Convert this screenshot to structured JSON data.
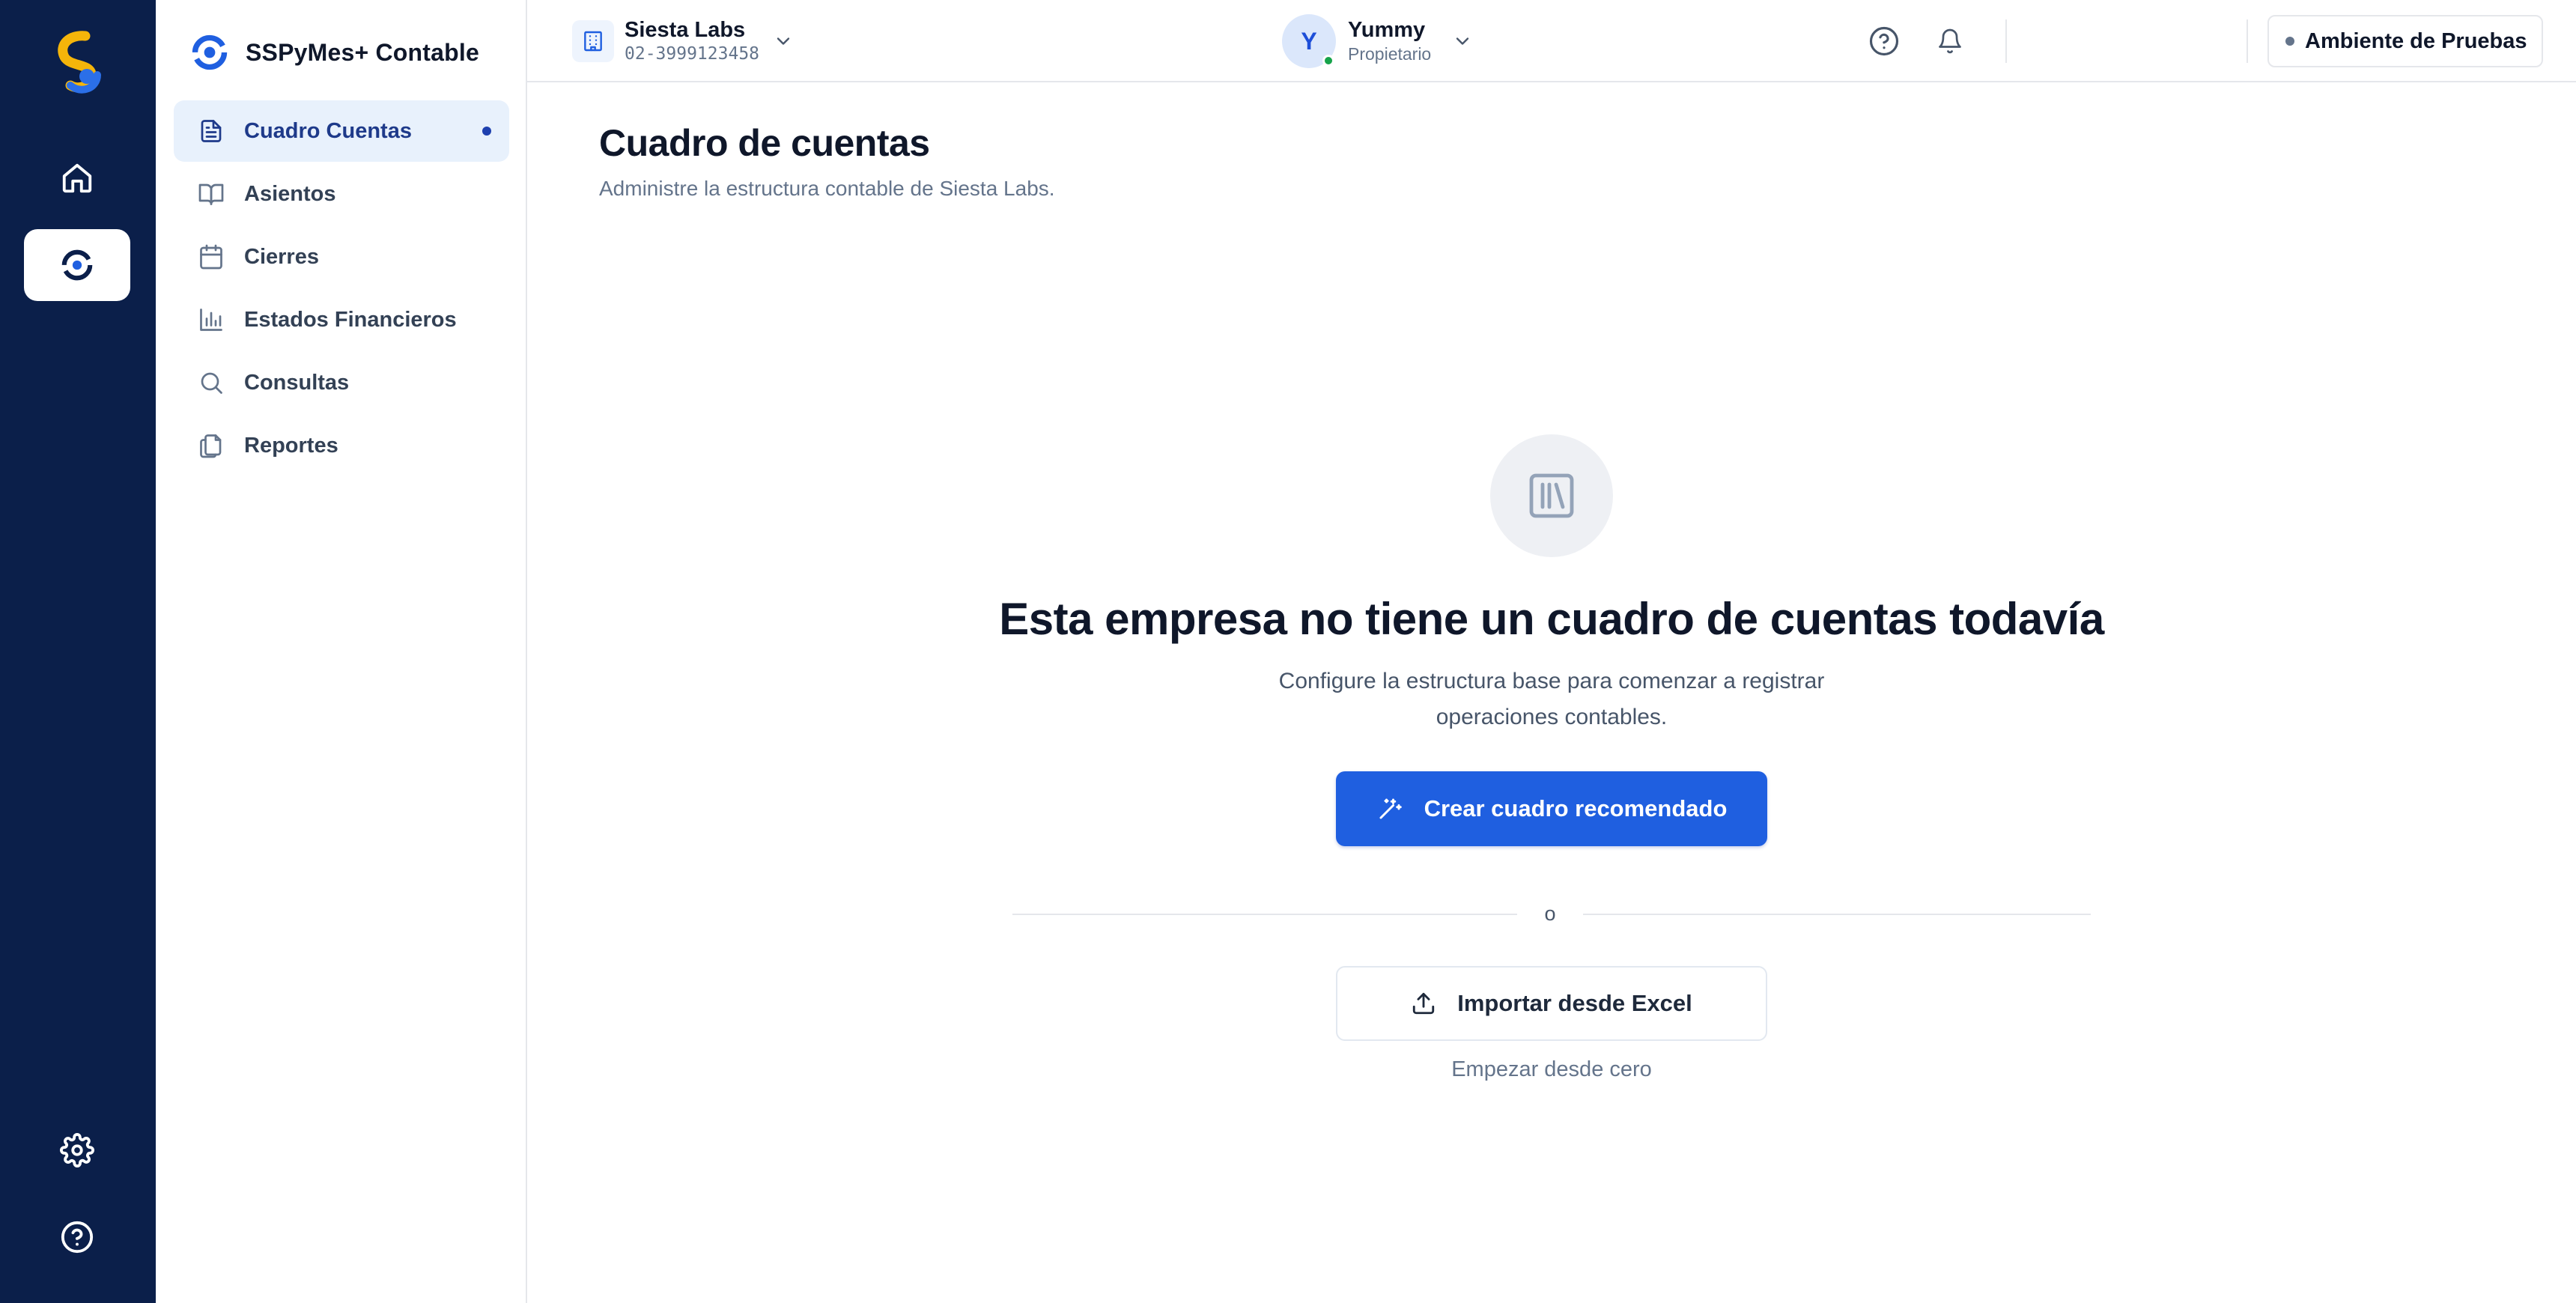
{
  "rail": {
    "items": [
      {
        "name": "home",
        "icon": "home-icon"
      },
      {
        "name": "accounting",
        "icon": "accounting-module-icon",
        "active": true
      }
    ],
    "bottom": [
      {
        "name": "settings",
        "icon": "gear-icon"
      },
      {
        "name": "help",
        "icon": "help-circle-icon"
      }
    ]
  },
  "sidebar": {
    "brand": "SSPyMes+ Contable",
    "items": [
      {
        "label": "Cuadro Cuentas",
        "icon": "document-icon",
        "active": true
      },
      {
        "label": "Asientos",
        "icon": "book-open-icon"
      },
      {
        "label": "Cierres",
        "icon": "calendar-icon"
      },
      {
        "label": "Estados Financieros",
        "icon": "bar-chart-icon"
      },
      {
        "label": "Consultas",
        "icon": "search-icon"
      },
      {
        "label": "Reportes",
        "icon": "files-icon"
      }
    ]
  },
  "topbar": {
    "company": {
      "name": "Siesta Labs",
      "ruc": "02-3999123458"
    },
    "user": {
      "initial": "Y",
      "name": "Yummy",
      "role": "Propietario"
    },
    "environment": "Ambiente de Pruebas"
  },
  "main": {
    "title": "Cuadro de cuentas",
    "subtitle": "Administre la estructura contable de Siesta Labs."
  },
  "empty_state": {
    "title": "Esta empresa no tiene un cuadro de cuentas todavía",
    "description": "Configure la estructura base para comenzar a registrar operaciones contables.",
    "primary_action": "Crear cuadro recomendado",
    "separator": "o",
    "secondary_action": "Importar desde Excel",
    "link": "Empezar desde cero"
  },
  "colors": {
    "rail_bg": "#0b1f4a",
    "primary": "#1f5fe0",
    "active_nav_bg": "#e8f1fc",
    "active_nav_text": "#1e3a8a",
    "online_status": "#16a34a"
  }
}
